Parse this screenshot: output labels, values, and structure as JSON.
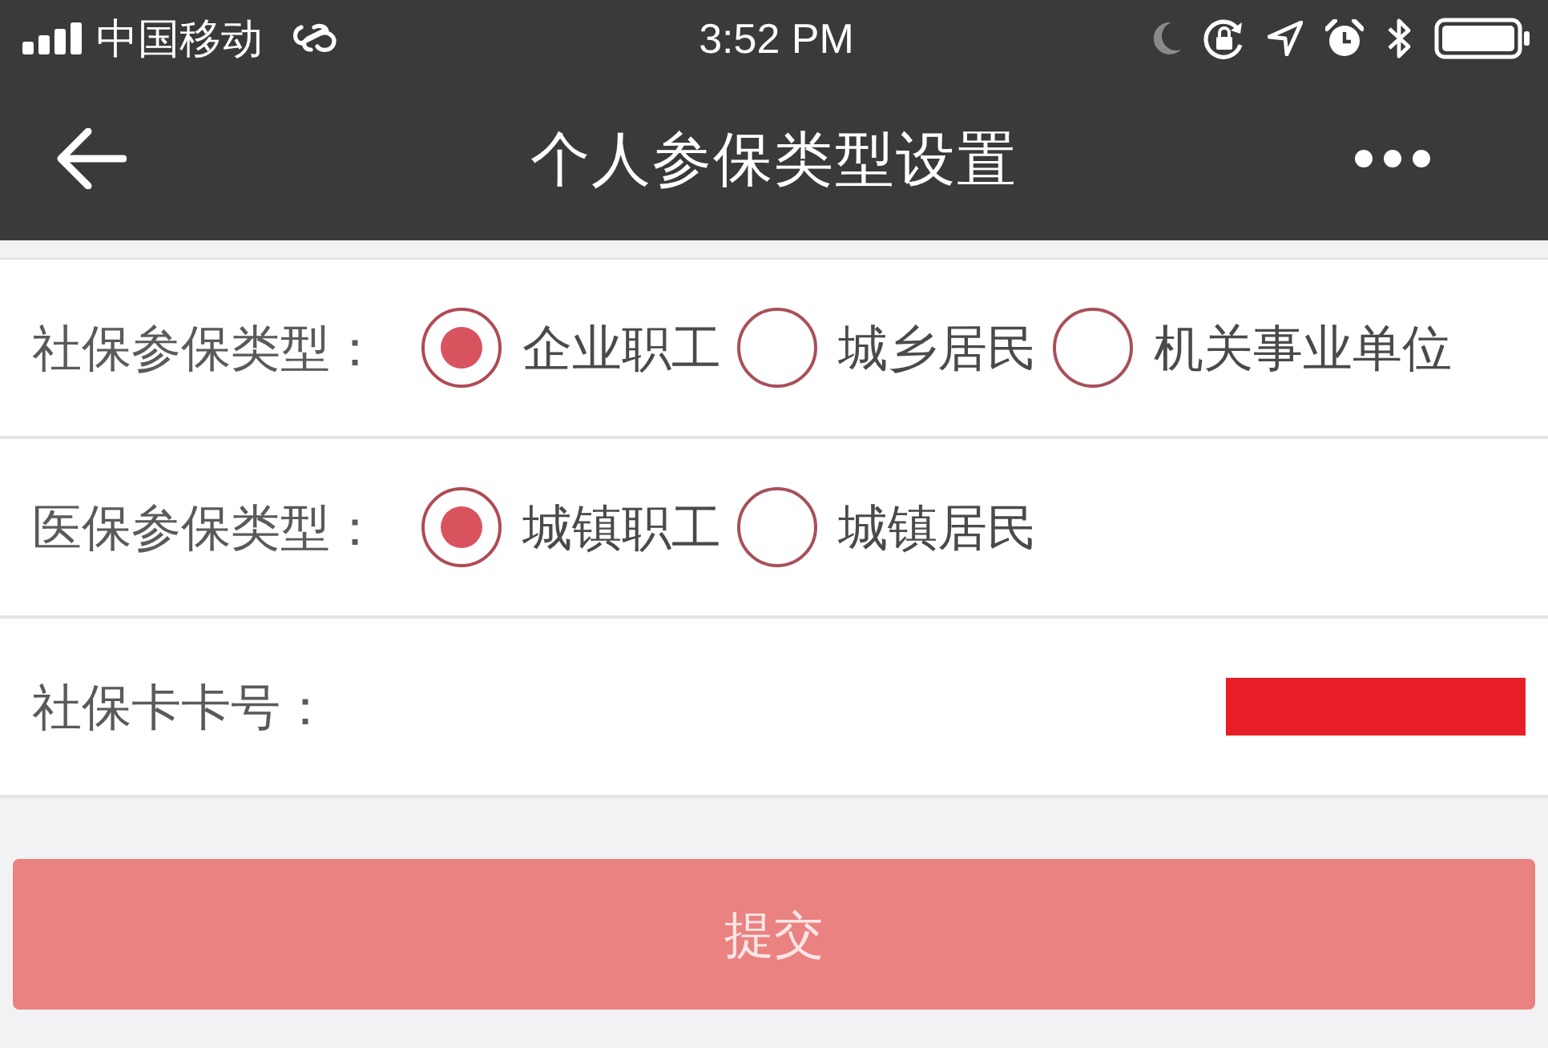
{
  "status_bar": {
    "carrier": "中国移动",
    "time": "3:52 PM"
  },
  "nav_bar": {
    "title": "个人参保类型设置"
  },
  "form": {
    "rows": [
      {
        "kind": "radio",
        "label": "社保参保类型：",
        "options": [
          {
            "label": "企业职工",
            "selected": true
          },
          {
            "label": "城乡居民",
            "selected": false
          },
          {
            "label": "机关事业单位",
            "selected": false
          }
        ]
      },
      {
        "kind": "radio",
        "label": "医保参保类型：",
        "options": [
          {
            "label": "城镇职工",
            "selected": true
          },
          {
            "label": "城镇居民",
            "selected": false
          }
        ]
      },
      {
        "kind": "text",
        "label": "社保卡卡号：",
        "redacted": true
      }
    ]
  },
  "submit_button": {
    "label": "提交",
    "disabled": true
  }
}
